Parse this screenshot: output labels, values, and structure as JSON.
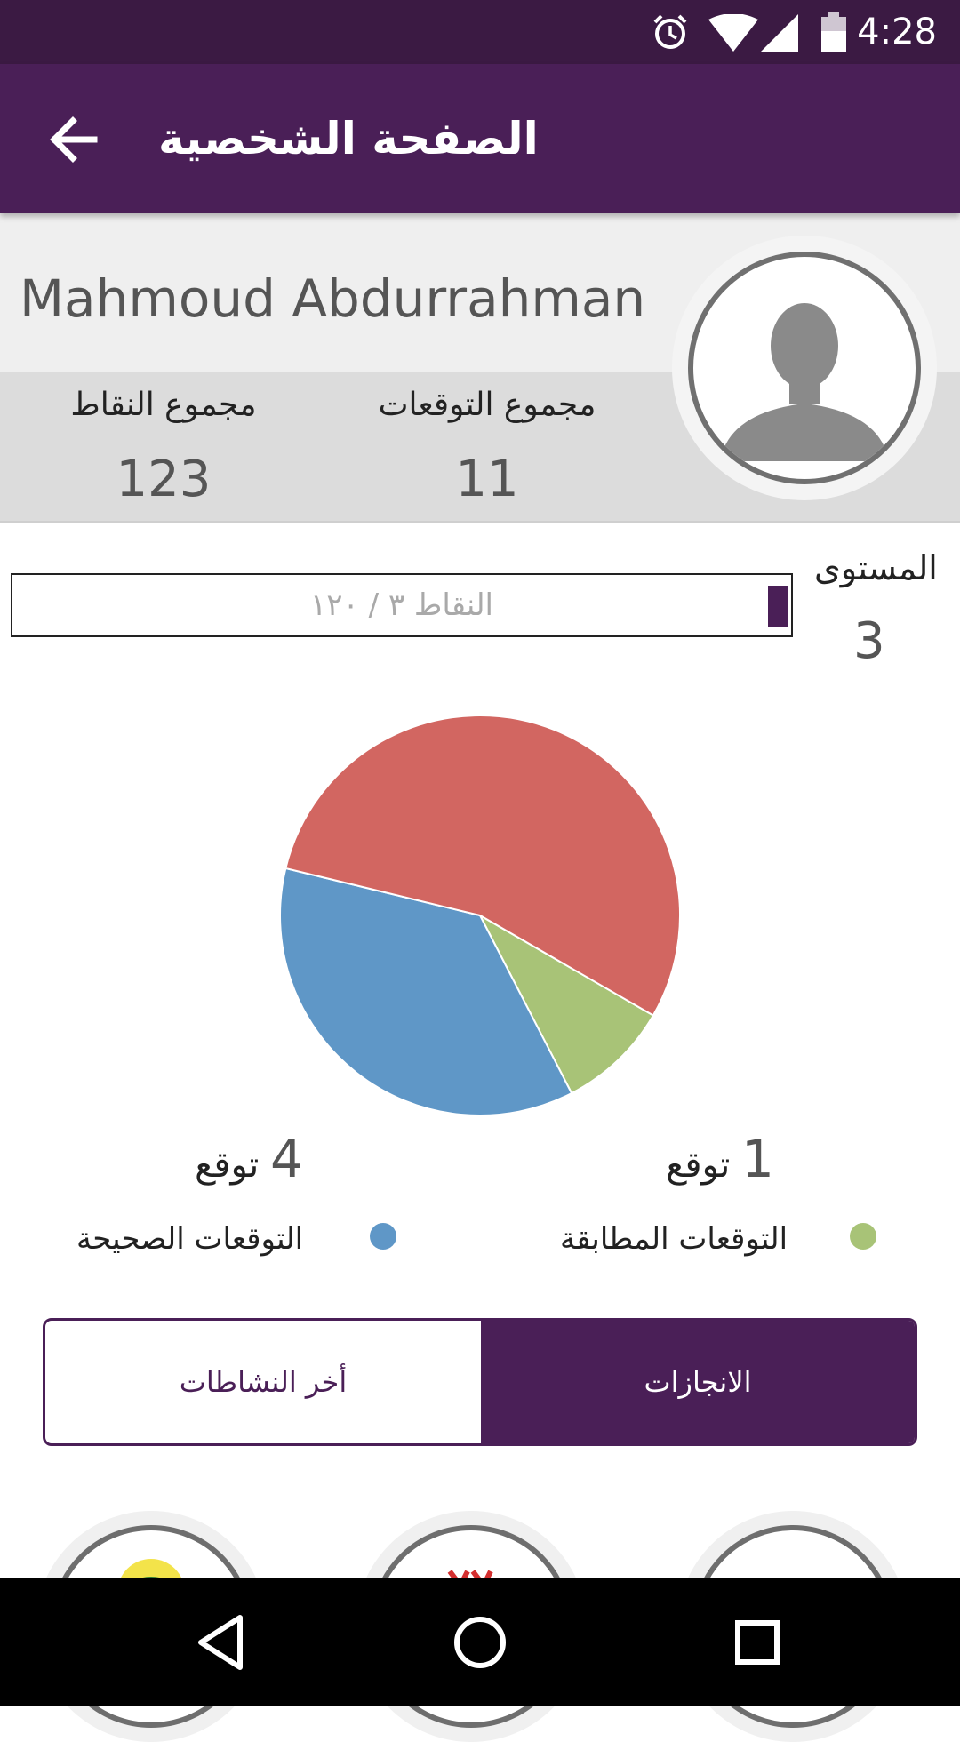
{
  "status_bar": {
    "time": "4:28",
    "icons": [
      "alarm-icon",
      "wifi-icon",
      "signal-icon",
      "battery-icon"
    ]
  },
  "app_bar": {
    "title": "الصفحة الشخصية",
    "back_icon": "arrow-back-icon"
  },
  "profile": {
    "name": "Mahmoud Abdurrahman",
    "stats": {
      "total_points_label": "مجموع النقاط",
      "total_points_value": "123",
      "total_predictions_label": "مجموع التوقعات",
      "total_predictions_value": "11"
    },
    "level": {
      "label": "المستوى",
      "value": "3",
      "progress_text": "النقاط ٣ / ١٢٠",
      "progress_fraction": 0.025
    }
  },
  "chart_data": {
    "type": "pie",
    "slices": [
      {
        "value": 1,
        "color": "#a8c377"
      },
      {
        "value": 4,
        "color": "#5f97c7"
      },
      {
        "value": 6,
        "color": "#d26661"
      }
    ]
  },
  "legend": {
    "correct": {
      "count": "4",
      "unit": "توقع",
      "label": "التوقعات الصحيحة",
      "color": "#5f97c7"
    },
    "exact": {
      "count": "1",
      "unit": "توقع",
      "label": "التوقعات المطابقة",
      "color": "#a8c377"
    }
  },
  "tabs": {
    "achievements": "الانجازات",
    "activities": "أخر النشاطات",
    "selected": "achievements"
  },
  "colors": {
    "primary": "#4a1f57",
    "status_bar": "#3b1a43",
    "red_slice": "#d26661",
    "blue_slice": "#5f97c7",
    "green_slice": "#a8c377"
  }
}
